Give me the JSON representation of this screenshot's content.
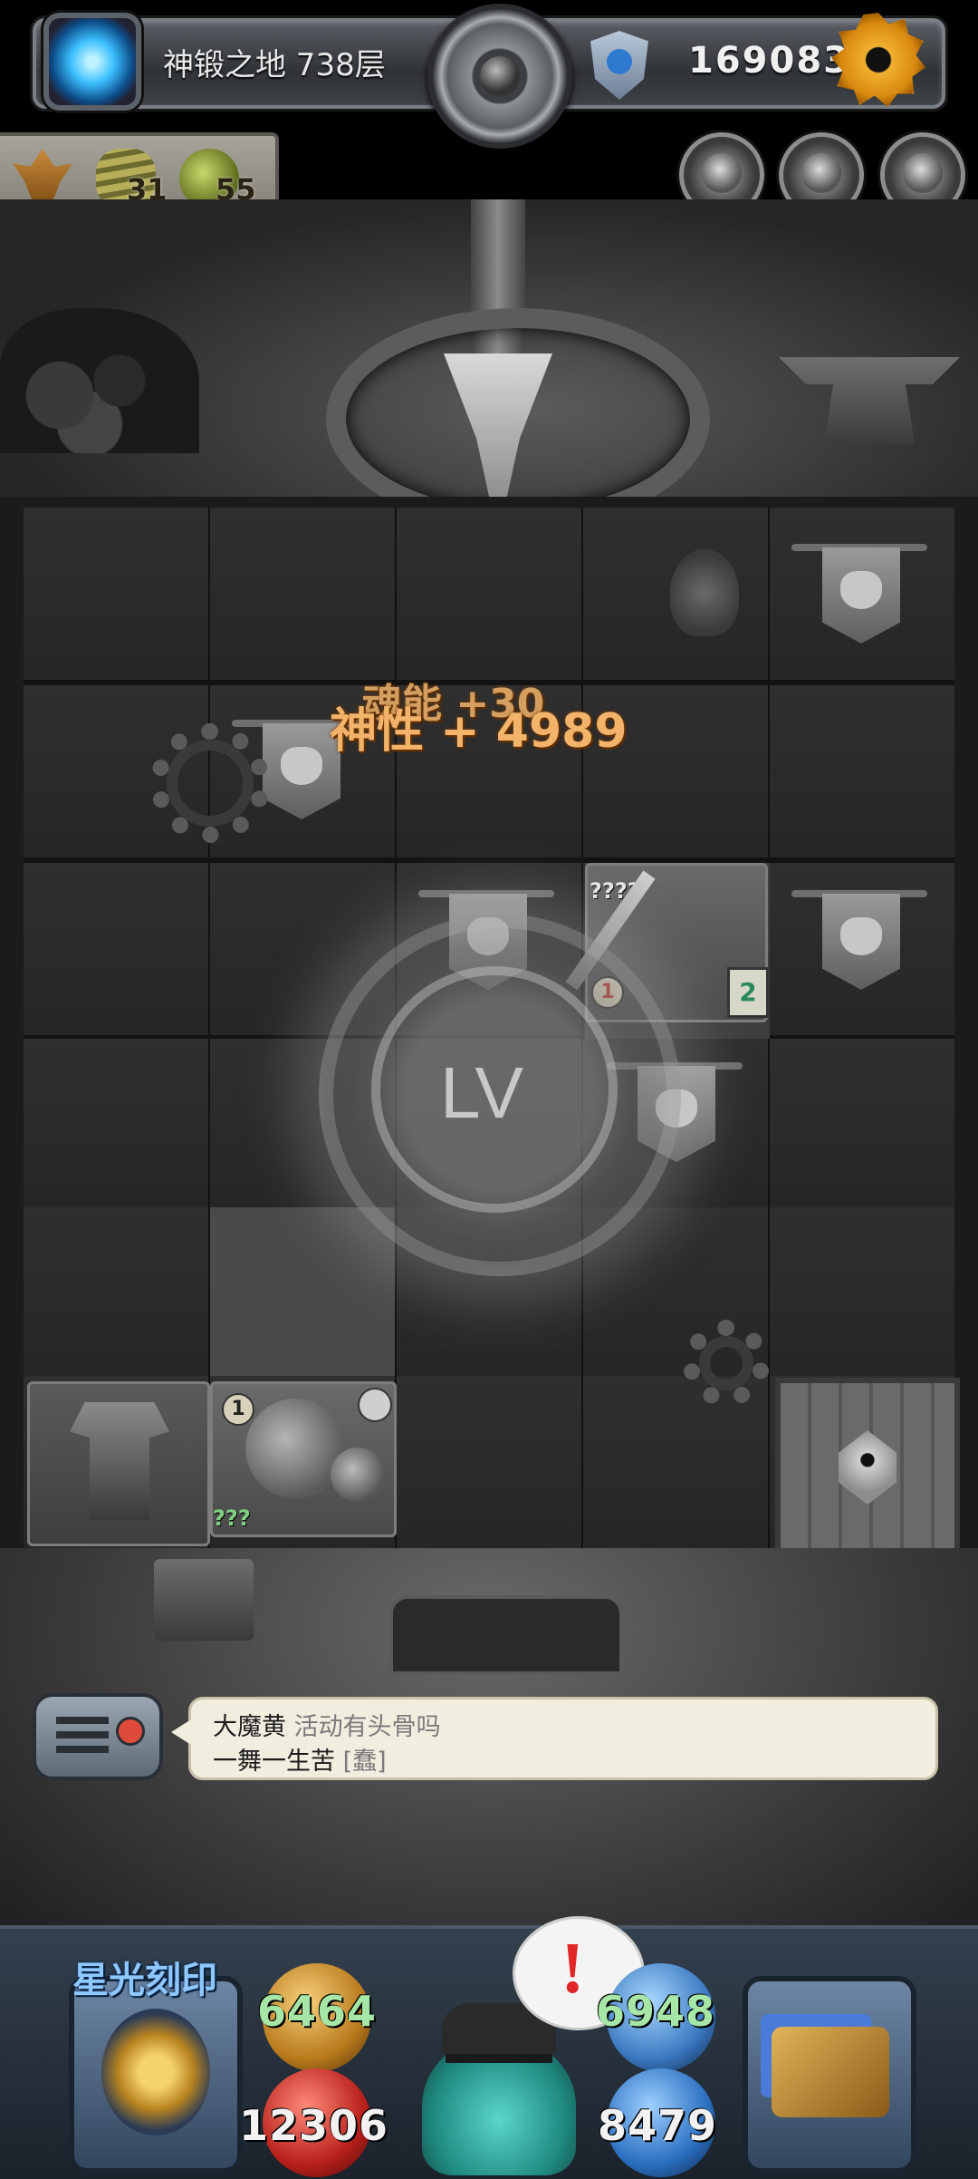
{
  "header": {
    "floor_text": "神锻之地 738层",
    "currency": "169083",
    "icons": {
      "portal": "portal-icon",
      "center": "bomb-dial-icon",
      "shield": "shield-icon",
      "settings": "gear-icon"
    }
  },
  "resources": {
    "items": [
      {
        "icon": "idol-icon",
        "count": ""
      },
      {
        "icon": "coil-icon",
        "count": "31"
      },
      {
        "icon": "rock-icon",
        "count": "55"
      }
    ]
  },
  "quick_buttons": [
    "monster-portrait-1-icon",
    "monster-portrait-2-icon",
    "monster-portrait-3-icon"
  ],
  "board": {
    "float_text_back": "魂能 +30",
    "float_text_front": "神性 + 4989",
    "lv_label": "LV",
    "weapon_tile": {
      "label": "????",
      "level": "1",
      "scroll_count": "2"
    },
    "pumpkin_tile": {
      "label": "???",
      "level": "1"
    }
  },
  "chat": {
    "user1_name": "大魔黄",
    "user1_msg": "活动有头骨吗",
    "user2_name": "一舞一生苦",
    "user2_msg": "[蠢]"
  },
  "bottom": {
    "title": "星光刻印",
    "alert": "!",
    "stats": {
      "attack_left": "6464",
      "hp": "12306",
      "attack_right": "6948",
      "defense": "8479"
    }
  },
  "colors": {
    "float_text": "#f2b36a",
    "stat_green": "#a6e6a6",
    "title_blue": "#8ec8ff",
    "alert_red": "#e02626"
  }
}
